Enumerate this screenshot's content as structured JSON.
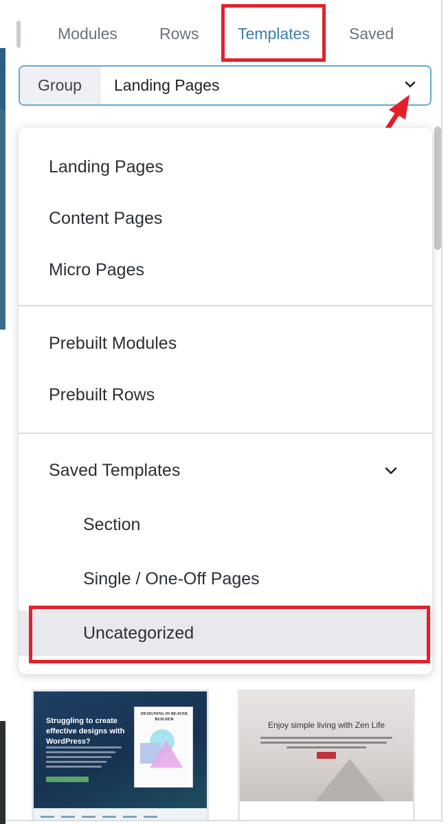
{
  "tabs": [
    {
      "label": "Modules",
      "active": false
    },
    {
      "label": "Rows",
      "active": false
    },
    {
      "label": "Templates",
      "active": true
    },
    {
      "label": "Saved",
      "active": false
    }
  ],
  "group_select": {
    "label": "Group",
    "value": "Landing Pages"
  },
  "dropdown": {
    "sections": [
      {
        "items": [
          "Landing Pages",
          "Content Pages",
          "Micro Pages"
        ]
      },
      {
        "items": [
          "Prebuilt Modules",
          "Prebuilt Rows"
        ]
      },
      {
        "parent": "Saved Templates",
        "children": [
          "Section",
          "Single / One-Off Pages",
          "Uncategorized"
        ],
        "selected": "Uncategorized"
      }
    ]
  },
  "cards": [
    {
      "headline": "Struggling to create effective designs with WordPress?",
      "book_title": "DESIGNING IN BEAVER BUILDER"
    },
    {
      "headline": "Enjoy simple living with Zen Life"
    }
  ],
  "colors": {
    "accent": "#3c7fab",
    "annotation_red": "#e4202a",
    "selected_bg": "#e7e9ec"
  },
  "icons": [
    "chevron-down-icon",
    "annotation-arrow"
  ]
}
